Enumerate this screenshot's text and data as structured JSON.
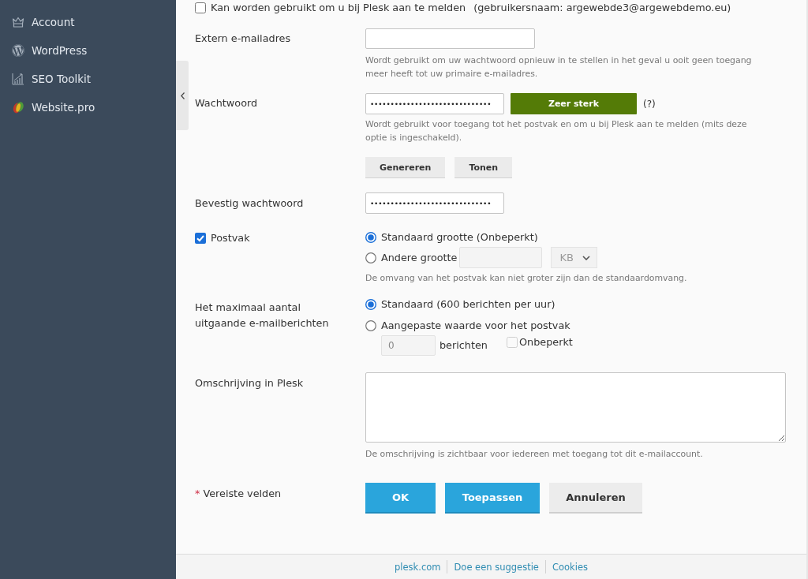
{
  "sidebar": {
    "items": [
      {
        "label": "Account"
      },
      {
        "label": "WordPress"
      },
      {
        "label": "SEO Toolkit"
      },
      {
        "label": "Website.pro"
      }
    ]
  },
  "login_option": {
    "label": "Kan worden gebruikt om u bij Plesk aan te melden",
    "note": "(gebruikersnaam: argewebde3@argewebdemo.eu)",
    "checked": false
  },
  "external_email": {
    "label": "Extern e-mailadres",
    "hint": "Wordt gebruikt om uw wachtwoord opnieuw in te stellen in het geval u ooit geen toegang meer heeft tot uw primaire e-mailadres."
  },
  "password": {
    "label": "Wachtwoord",
    "value": "••••••••••••••••••••••••••••••",
    "strength": "Zeer sterk",
    "help": "(?)",
    "hint": "Wordt gebruikt voor toegang tot het postvak en om u bij Plesk aan te melden (mits deze optie is ingeschakeld).",
    "buttons": [
      "Genereren",
      "Tonen"
    ]
  },
  "confirm_password": {
    "label": "Bevestig wachtwoord",
    "value": "••••••••••••••••••••••••••••••"
  },
  "mailbox": {
    "label": "Postvak",
    "checked": true,
    "options": [
      {
        "kind": "plain",
        "label": "Standaard grootte (Onbeperkt)",
        "selected": true
      },
      {
        "kind": "size",
        "label": "Andere grootte",
        "selected": false,
        "unit": "KB"
      }
    ],
    "hint": "De omvang van het postvak kan niet groter zijn dan de standaardomvang."
  },
  "outgoing_limit": {
    "label": "Het maximaal aantal uitgaande e-mailberichten",
    "options": [
      {
        "kind": "plain",
        "label": "Standaard (600 berichten per uur)",
        "selected": true
      },
      {
        "kind": "custom",
        "label": "Aangepaste waarde voor het postvak",
        "selected": false,
        "value": "0",
        "unit": "berichten",
        "unlimited": {
          "label": "Onbeperkt",
          "checked": false
        }
      }
    ]
  },
  "description": {
    "label": "Omschrijving in Plesk",
    "hint": "De omschrijving is zichtbaar voor iedereen met toegang tot dit e-mailaccount."
  },
  "required_note": {
    "marker": "*",
    "text": "Vereiste velden"
  },
  "buttons": [
    {
      "label": "OK",
      "kind": "primary"
    },
    {
      "label": "Toepassen",
      "kind": "primary"
    },
    {
      "label": "Annuleren",
      "kind": "secondary"
    }
  ],
  "footer": {
    "links": [
      "plesk.com",
      "Doe een suggestie",
      "Cookies"
    ]
  }
}
